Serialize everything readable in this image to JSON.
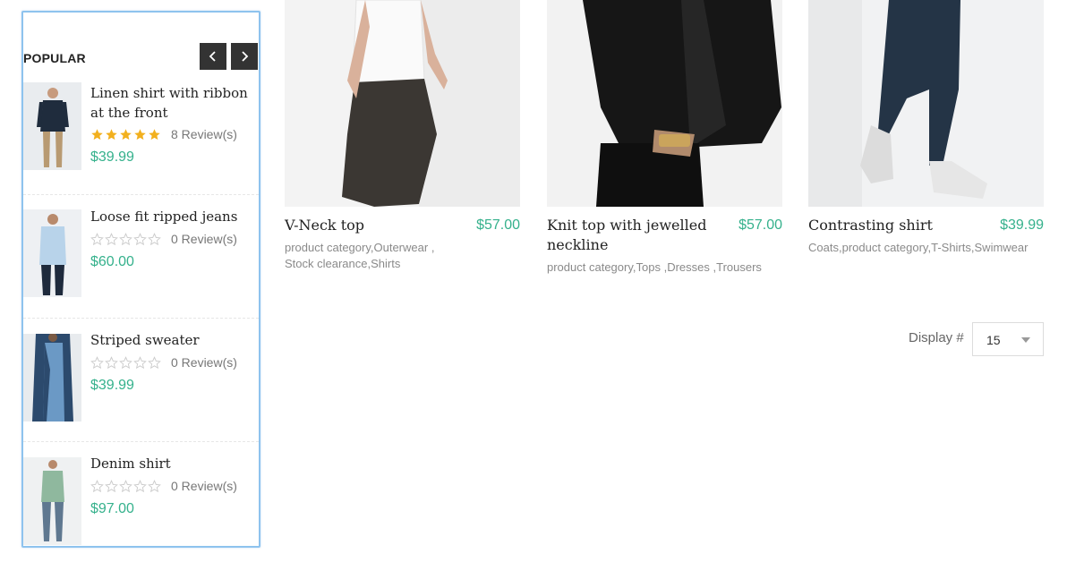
{
  "sidebar": {
    "title": "POPULAR",
    "prev_icon": "chevron-left-icon",
    "next_icon": "chevron-right-icon",
    "items": [
      {
        "name": "Linen shirt with ribbon at the front",
        "rating": 5,
        "reviews": "8 Review(s)",
        "price": "$39.99"
      },
      {
        "name": "Loose fit ripped jeans",
        "rating": 0,
        "reviews": "0 Review(s)",
        "price": "$60.00"
      },
      {
        "name": "Striped sweater",
        "rating": 0,
        "reviews": "0 Review(s)",
        "price": "$39.99"
      },
      {
        "name": "Denim shirt",
        "rating": 0,
        "reviews": "0 Review(s)",
        "price": "$97.00"
      }
    ]
  },
  "products": [
    {
      "name": "V-Neck top",
      "price": "$57.00",
      "categories": [
        "product category",
        "Outerwear",
        "Stock clearance",
        "Shirts"
      ]
    },
    {
      "name": "Knit top with jewelled neckline",
      "price": "$57.00",
      "categories": [
        "product category",
        "Tops",
        "Dresses",
        "Trousers"
      ]
    },
    {
      "name": "Contrasting shirt",
      "price": "$39.99",
      "categories": [
        "Coats",
        "product category",
        "T-Shirts",
        "Swimwear"
      ]
    }
  ],
  "display": {
    "label": "Display #",
    "value": "15"
  },
  "colors": {
    "accent_price": "#35b18c",
    "star_filled": "#f2b01e",
    "star_empty": "#cccccc",
    "nav_button": "#333333",
    "sidebar_border": "#8ec3ee"
  }
}
